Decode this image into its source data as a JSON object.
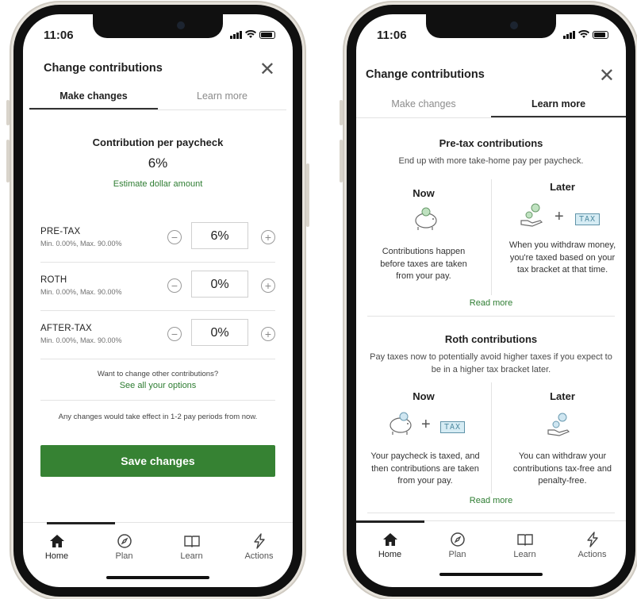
{
  "left": {
    "time": "11:06",
    "title": "Change contributions",
    "close_glyph": "✕",
    "tabs": [
      "Make changes",
      "Learn more"
    ],
    "active_tab": 0,
    "contribution_heading": "Contribution per paycheck",
    "contribution_value": "6%",
    "estimate_link": "Estimate dollar amount",
    "rows": [
      {
        "label": "PRE-TAX",
        "range": "Min. 0.00%, Max. 90.00%",
        "value": "6%"
      },
      {
        "label": "ROTH",
        "range": "Min. 0.00%, Max. 90.00%",
        "value": "0%"
      },
      {
        "label": "AFTER-TAX",
        "range": "Min. 0.00%, Max. 90.00%",
        "value": "0%"
      }
    ],
    "minus_glyph": "−",
    "plus_glyph": "+",
    "other_question": "Want to change other contributions?",
    "options_link": "See all your options",
    "effect_note": "Any changes would take effect in 1-2 pay periods from now.",
    "save_label": "Save changes"
  },
  "right": {
    "time": "11:06",
    "title": "Change contributions",
    "close_glyph": "✕",
    "tabs": [
      "Make changes",
      "Learn more"
    ],
    "active_tab": 1,
    "pretax": {
      "heading": "Pre-tax contributions",
      "desc": "End up with more take-home pay per paycheck.",
      "now_label": "Now",
      "later_label": "Later",
      "now_text": "Contributions happen before taxes are taken from your pay.",
      "later_text": "When you withdraw money, you're taxed based on your tax bracket at that time.",
      "read_more": "Read more"
    },
    "roth": {
      "heading": "Roth contributions",
      "desc": "Pay taxes now to potentially avoid higher taxes if you expect to be in a higher tax bracket later.",
      "now_label": "Now",
      "later_label": "Later",
      "now_text": "Your paycheck is taxed, and then contributions are taken from your pay.",
      "later_text": "You can withdraw your contributions tax-free and penalty-free.",
      "read_more": "Read more"
    },
    "tax_label": "TAX",
    "plus_glyph": "+"
  },
  "nav": [
    {
      "label": "Home",
      "icon": "home-icon"
    },
    {
      "label": "Plan",
      "icon": "compass-icon"
    },
    {
      "label": "Learn",
      "icon": "book-icon"
    },
    {
      "label": "Actions",
      "icon": "lightning-icon"
    }
  ],
  "colors": {
    "accent_green": "#368233",
    "link_green": "#2e7d32",
    "tax_blue": "#5f93a8"
  }
}
